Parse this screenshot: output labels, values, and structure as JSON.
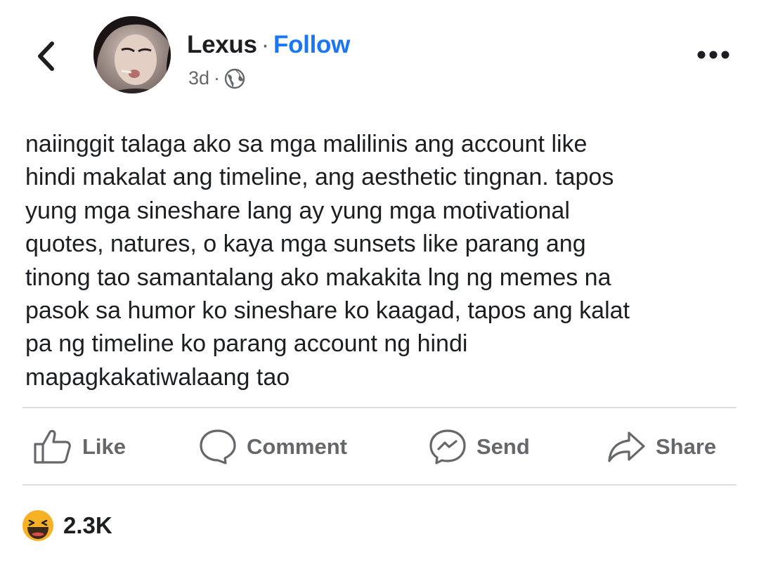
{
  "header": {
    "back_icon": "chevron-left-icon",
    "author_name": "Lexus",
    "separator": "·",
    "follow_label": "Follow",
    "time": "3d",
    "meta_separator": "·",
    "audience_icon": "globe-icon",
    "more_icon": "more-horizontal-icon"
  },
  "post": {
    "text_lines": [
      "naiinggit talaga ako sa mga malilinis ang account like",
      "hindi makalat ang timeline, ang aesthetic tingnan. tapos",
      "yung mga sineshare lang ay yung mga motivational",
      "quotes, natures, o kaya mga sunsets like parang ang",
      "tinong tao samantalang ako makakita lng ng memes na",
      "pasok sa humor ko sineshare ko kaagad, tapos ang kalat",
      "pa ng timeline ko parang account ng hindi",
      "mapagkakatiwalaang tao"
    ]
  },
  "actions": {
    "like": {
      "label": "Like",
      "icon": "thumbs-up-icon"
    },
    "comment": {
      "label": "Comment",
      "icon": "comment-icon"
    },
    "send": {
      "label": "Send",
      "icon": "messenger-icon"
    },
    "share": {
      "label": "Share",
      "icon": "share-icon"
    }
  },
  "reactions": {
    "icon": "haha-reaction-icon",
    "count": "2.3K"
  },
  "colors": {
    "follow": "#1877f2",
    "secondary_text": "#65676b",
    "divider": "#dadde1",
    "reaction_yellow": "#f7b125"
  }
}
